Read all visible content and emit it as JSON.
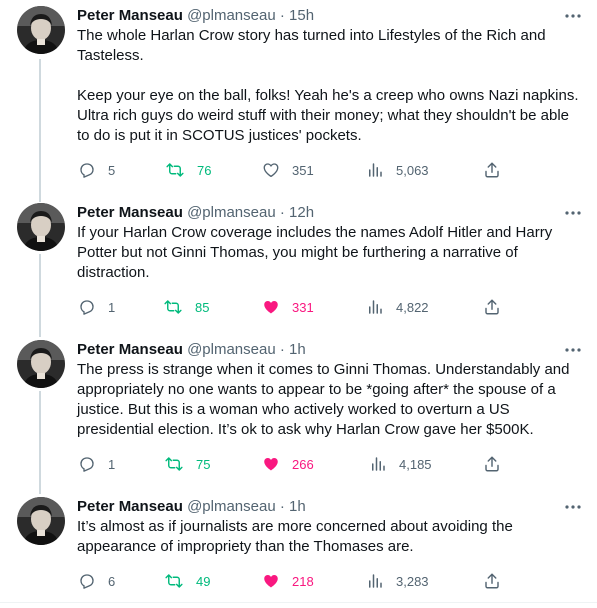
{
  "tweets": [
    {
      "name": "Peter Manseau",
      "handle": "@plmanseau",
      "time": "15h",
      "text": "The whole Harlan Crow story has turned into Lifestyles of the Rich and Tasteless.\n\nKeep your eye on the ball, folks! Yeah he's a creep who owns Nazi napkins. Ultra rich guys do weird stuff with their money; what they shouldn't be able to do is put it in SCOTUS justices' pockets.",
      "replies": "5",
      "retweets": "76",
      "likes": "351",
      "views": "5,063",
      "liked": false
    },
    {
      "name": "Peter Manseau",
      "handle": "@plmanseau",
      "time": "12h",
      "text": "If your Harlan Crow coverage includes the names Adolf Hitler and Harry Potter but not Ginni Thomas, you might be furthering a narrative of distraction.",
      "replies": "1",
      "retweets": "85",
      "likes": "331",
      "views": "4,822",
      "liked": true
    },
    {
      "name": "Peter Manseau",
      "handle": "@plmanseau",
      "time": "1h",
      "text": "The press is strange when it comes to Ginni Thomas. Understandably and appropriately no one wants to appear to be *going after* the spouse of a justice. But this is a woman who actively worked to overturn a US presidential election. It’s ok to ask why Harlan Crow gave her $500K.",
      "replies": "1",
      "retweets": "75",
      "likes": "266",
      "views": "4,185",
      "liked": true
    },
    {
      "name": "Peter Manseau",
      "handle": "@plmanseau",
      "time": "1h",
      "text": "It’s almost as if journalists are more concerned about avoiding the appearance of impropriety than the Thomases are.",
      "replies": "6",
      "retweets": "49",
      "likes": "218",
      "views": "3,283",
      "liked": true
    }
  ],
  "separator": "·",
  "icons": {
    "more": "more-horizontal-icon",
    "reply": "reply-icon",
    "retweet": "retweet-icon",
    "like": "heart-icon",
    "views": "views-chart-icon",
    "share": "share-icon"
  },
  "colors": {
    "text": "#0f1419",
    "secondary": "#536471",
    "retweet": "#00ba7c",
    "like": "#f91880",
    "thread_line": "#cfd9de"
  }
}
